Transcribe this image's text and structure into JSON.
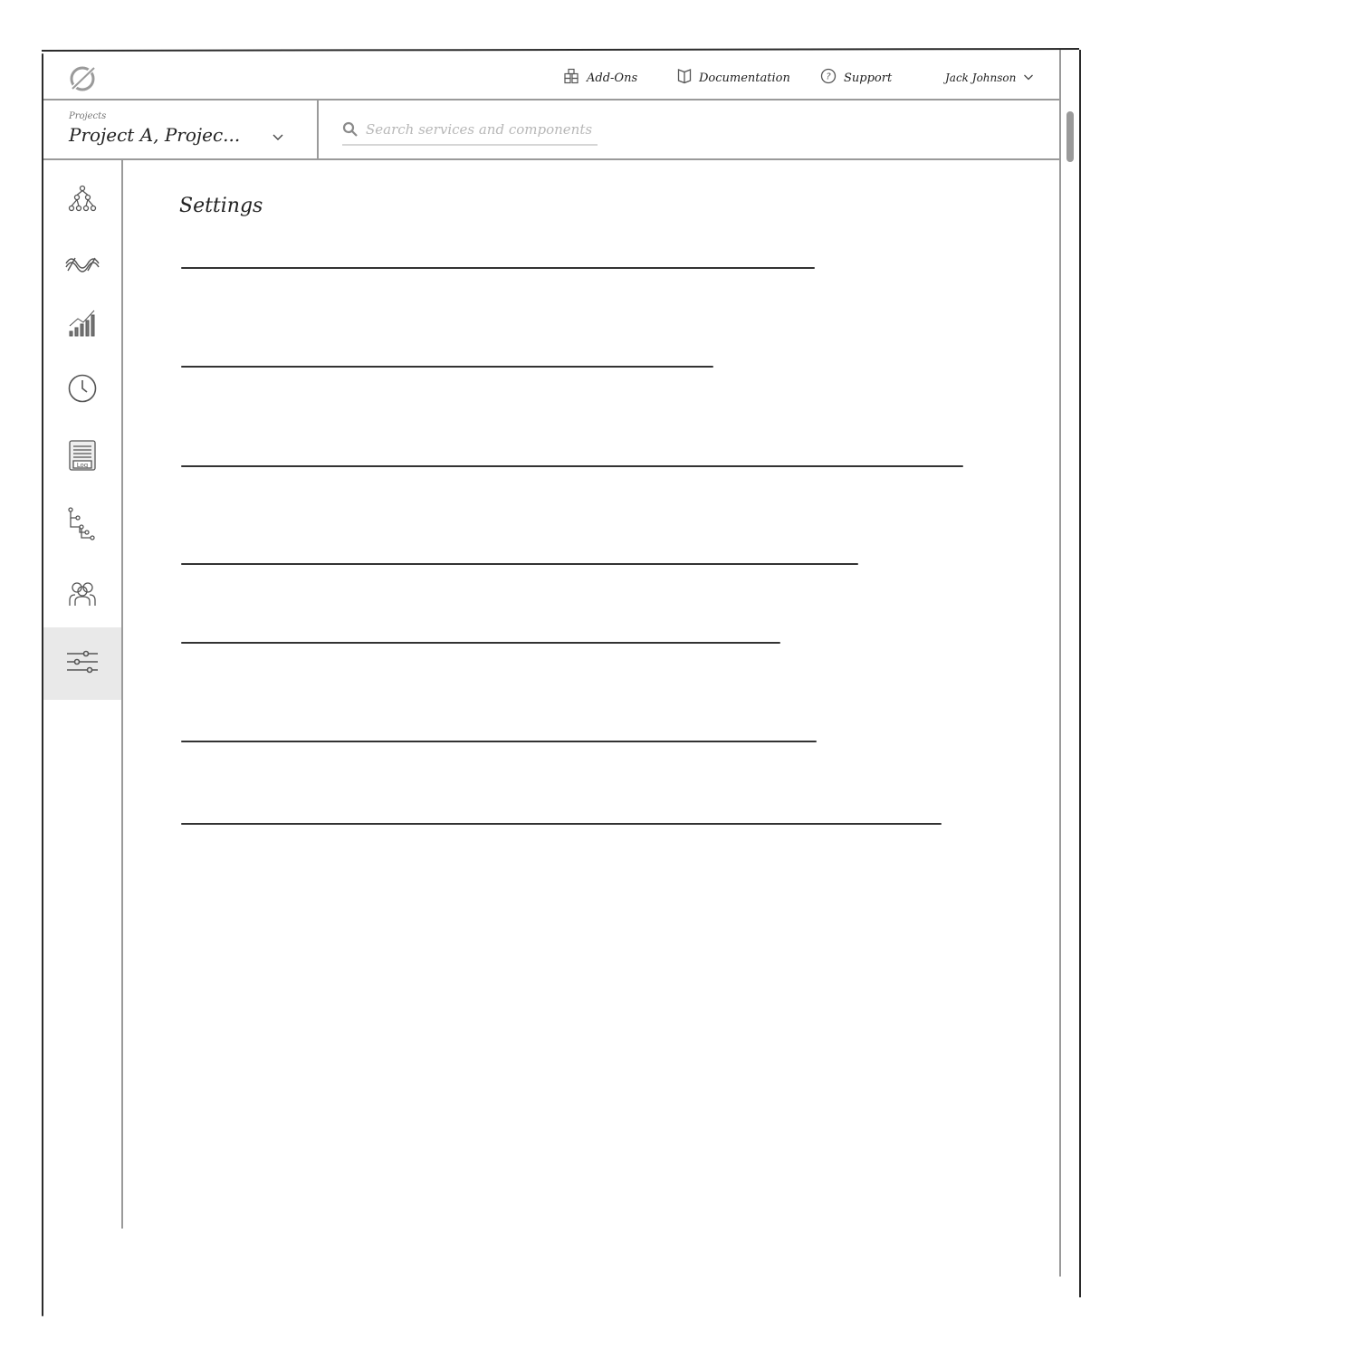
{
  "topbar": {
    "nav": [
      {
        "label": "Add-Ons",
        "icon": "addons-icon"
      },
      {
        "label": "Documentation",
        "icon": "book-icon"
      },
      {
        "label": "Support",
        "icon": "help-circle-icon"
      }
    ],
    "user_name": "Jack Johnson"
  },
  "project_selector": {
    "caption": "Projects",
    "value": "Project A, Projec..."
  },
  "search": {
    "placeholder": "Search services and components"
  },
  "sidebar": {
    "items": [
      {
        "icon": "topology-icon",
        "active": false
      },
      {
        "icon": "signal-waves-icon",
        "active": false
      },
      {
        "icon": "bar-chart-icon",
        "active": false
      },
      {
        "icon": "clock-icon",
        "active": false
      },
      {
        "icon": "log-file-icon",
        "active": false
      },
      {
        "icon": "tree-icon",
        "active": false
      },
      {
        "icon": "users-icon",
        "active": false
      },
      {
        "icon": "sliders-icon",
        "active": true
      }
    ]
  },
  "main": {
    "title": "Settings"
  }
}
